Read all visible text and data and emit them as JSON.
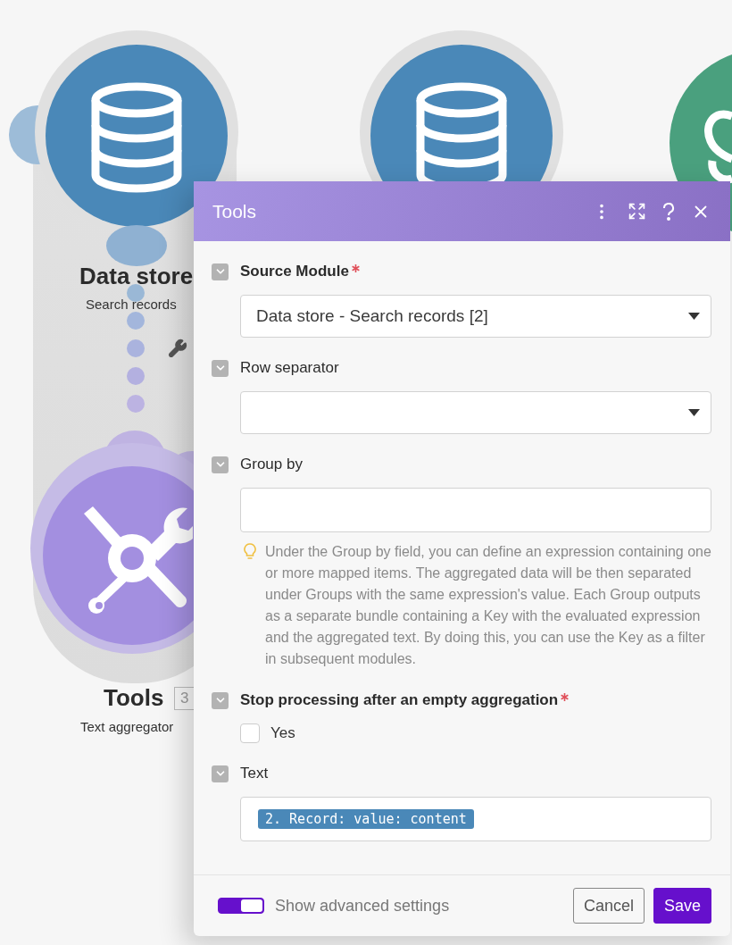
{
  "canvas": {
    "nodes": [
      {
        "kind": "datastore",
        "title": "Data store",
        "subtitle": "Search records"
      },
      {
        "kind": "datastore"
      },
      {
        "kind": "ai"
      },
      {
        "kind": "tools",
        "title": "Tools",
        "badge": "3",
        "subtitle": "Text aggregator"
      }
    ]
  },
  "dialog": {
    "title": "Tools",
    "fields": [
      {
        "kind": "select",
        "label": "Source Module",
        "required": true,
        "value": "Data store - Search records [2]"
      },
      {
        "kind": "select",
        "label": "Row separator",
        "required": false
      },
      {
        "kind": "text",
        "label": "Group by",
        "required": false,
        "hint": "Under the Group by field, you can define an expression containing one or more mapped items. The aggregated data will be then separated under Groups with the same expression's value. Each Group outputs as a separate bundle containing a Key with the evaluated expression and the aggregated text. By doing this, you can use the Key as a filter in subsequent modules."
      },
      {
        "kind": "checkbox",
        "label": "Stop processing after an empty aggregation",
        "required": true,
        "option": "Yes",
        "checked": false
      },
      {
        "kind": "mapped",
        "label": "Text",
        "required": false,
        "chip": "2. Record: value: content"
      }
    ],
    "footer": {
      "advanced": {
        "label": "Show advanced settings",
        "on": true
      },
      "buttons": [
        "Cancel",
        "Save"
      ]
    }
  }
}
